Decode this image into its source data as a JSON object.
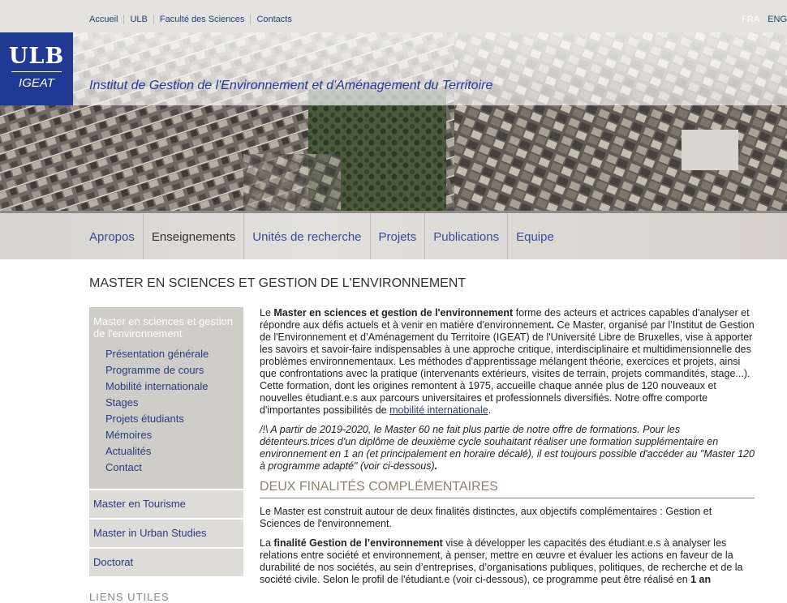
{
  "top_links": [
    "Accueil",
    "ULB",
    "Faculté des Sciences",
    "Contacts"
  ],
  "langs": {
    "fra": "FRA",
    "eng": "ENG"
  },
  "logo": {
    "ulb": "ULB",
    "igeat": "IGEAT"
  },
  "institute_title": "Institut de Gestion de l'Environnement et d'Aménagement du Territoire",
  "nav": [
    "Apropos",
    "Enseignements",
    "Unités de recherche",
    "Projets",
    "Publications",
    "Equipe"
  ],
  "page_title": "MASTER EN SCIENCES ET GESTION DE L'ENVIRONNEMENT",
  "sidebar": {
    "active_title": "Master en sciences et gestion de l'environnement",
    "sub_links": [
      "Présentation générale",
      "Programme de cours",
      "Mobilité internationale",
      "Stages",
      "Projets étudiants",
      "Mémoires",
      "Actualités",
      "Contact"
    ],
    "items": [
      "Master en Tourisme",
      "Master in Urban Studies",
      "Doctorat"
    ],
    "useful_links": "LIENS UTILES"
  },
  "content": {
    "p1_a": "Le ",
    "p1_b": "Master en sciences et gestion de l'environnement",
    "p1_c": " forme des acteurs et actrices capables d'analyser et répondre aux défis actuels et à venir en matière d'environnement",
    "p1_dot": ".",
    "p1_d": " Ce Master, organisé par l’Institut de Gestion de l'Environnement et d’Aménagement du Territoire (IGEAT) de l'Université Libre de Bruxelles, vise à apporter les savoirs et savoir-faire indispensables à une approche critique, interdisciplinaire et multidimensionnelle des problèmes environnementaux. Les méthodes d'apprentissage mélangent théorie, exercices et projets, ainsi que confrontations avec la pratique (intervenants extérieurs, visites de terrain, projets commandités, stage...). Cette formation, dont les origines remontent à 1975, accueille chaque année plus de 120 nouveaux et nouvelles étudiant.e.s aux parcours universitaires et professionnels diversifiés. Notre offre comporte d'importantes possibilités de ",
    "p1_link": "mobilité internationale",
    "p1_end": ".",
    "notice_mark": "/!\\",
    "notice_text": " A partir de 2019-2020, le Master 60 ne fait plus partie de notre offre de formations. Pour les détenteurs.trices d'un diplôme de deuxième cycle souhaitant réaliser une formation supplémentaire en environnement en 1 an (et principalement en horaire décalé), il est toujours possible d'accéder au \"Master 120 à programme adapté\" (voir ci-dessous)",
    "notice_end": ".",
    "section_title": "DEUX FINALITÉS COMPLÉMENTAIRES",
    "p2": "Le Master est construit autour de deux finalités distinctes, aux objectifs complémentaires : Gestion et Sciences de l'environnement.",
    "p3_a": "La ",
    "p3_b": "finalité Gestion de l’environnement",
    "p3_c": " vise à développer les capacités des étudiant.e.s à analyser les relations entre société et environnement, à penser, mettre en œuvre et évaluer les actions en faveur de la durabilité de nos sociétés, au sein d’entreprises, d’organisations publiques, politiques, de recherche et de la société civile. Selon le profil de l'étudiant.e (voir ci-dessous), ce programme peut être réalisé en ",
    "p3_d": "1 an"
  },
  "colors": {
    "brand_blue": "#1f3a93",
    "link": "#2b3a80",
    "section": "#8b8475",
    "sidebar_active": "#cfcdc7"
  }
}
